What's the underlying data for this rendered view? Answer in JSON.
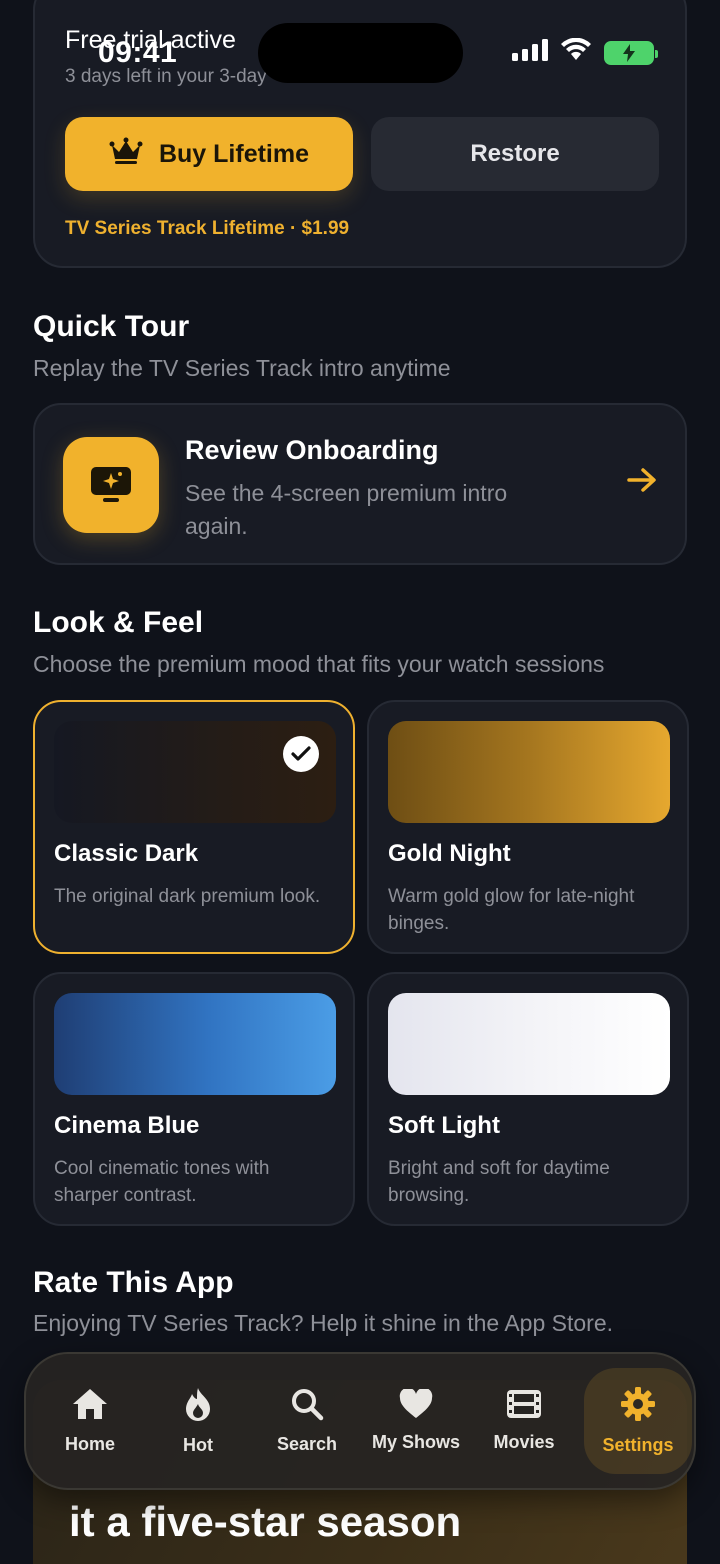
{
  "status_bar": {
    "time": "09:41"
  },
  "trial": {
    "title": "Free trial active",
    "subtitle": "3 days left in your 3-day",
    "buy_label": "Buy Lifetime",
    "restore_label": "Restore",
    "price_line": "TV Series Track Lifetime · $1.99"
  },
  "quick_tour": {
    "title": "Quick Tour",
    "subtitle": "Replay the TV Series Track intro anytime",
    "item_title": "Review Onboarding",
    "item_subtitle": "See the 4-screen premium intro again."
  },
  "look_feel": {
    "title": "Look & Feel",
    "subtitle": "Choose the premium mood that fits your watch sessions",
    "themes": [
      {
        "name": "Classic Dark",
        "desc": "The original dark premium look.",
        "selected": true
      },
      {
        "name": "Gold Night",
        "desc": "Warm gold glow for late-night binges.",
        "selected": false
      },
      {
        "name": "Cinema Blue",
        "desc": "Cool cinematic tones with sharper contrast.",
        "selected": false
      },
      {
        "name": "Soft Light",
        "desc": "Bright and soft for daytime browsing.",
        "selected": false
      }
    ]
  },
  "rate": {
    "title": "Rate This App",
    "subtitle": "Enjoying TV Series Track? Help it shine in the App Store.",
    "headline": "it a five-star season"
  },
  "tabs": [
    {
      "label": "Home",
      "icon": "house-icon"
    },
    {
      "label": "Hot",
      "icon": "flame-icon"
    },
    {
      "label": "Search",
      "icon": "magnifier-icon"
    },
    {
      "label": "My Shows",
      "icon": "heart-icon"
    },
    {
      "label": "Movies",
      "icon": "film-icon"
    },
    {
      "label": "Settings",
      "icon": "gear-icon",
      "active": true
    }
  ],
  "colors": {
    "accent": "#f1b22c",
    "background": "#0f121a",
    "card": "#181b24"
  }
}
